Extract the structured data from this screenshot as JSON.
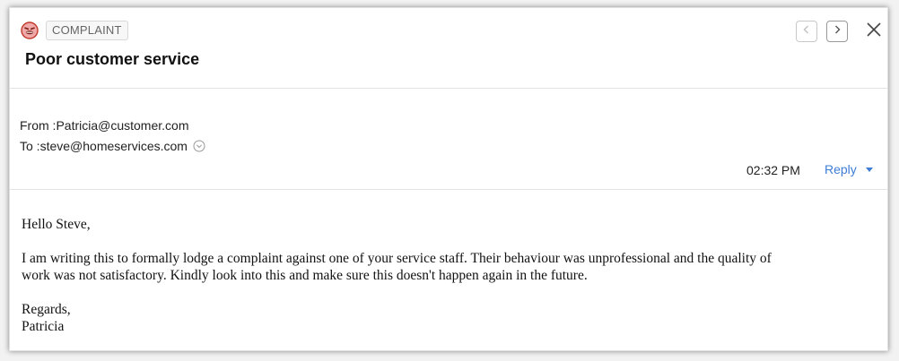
{
  "header": {
    "tag_label": "COMPLAINT",
    "tag_icon": "angry-face-icon",
    "tag_color": "#d9534f",
    "subject": "Poor customer service",
    "prev_icon": "chevron-left-icon",
    "next_icon": "chevron-right-icon",
    "close_icon": "close-icon"
  },
  "meta": {
    "from_label": "From : ",
    "from_value": "Patricia@customer.com",
    "to_label": "To : ",
    "to_value": "steve@homeservices.com",
    "expand_icon": "chevron-down-circle-icon",
    "time": "02:32 PM",
    "reply_label": "Reply",
    "reply_color": "#3d7dd6"
  },
  "body": {
    "greeting": "Hello Steve,",
    "line1": "I am writing this to formally lodge a complaint against one of your service staff. Their behaviour was unprofessional and the quality of",
    "line2": "work was not satisfactory. Kindly look into this and make sure this doesn't happen again in the future.",
    "closing": "Regards,",
    "signature": "Patricia"
  }
}
